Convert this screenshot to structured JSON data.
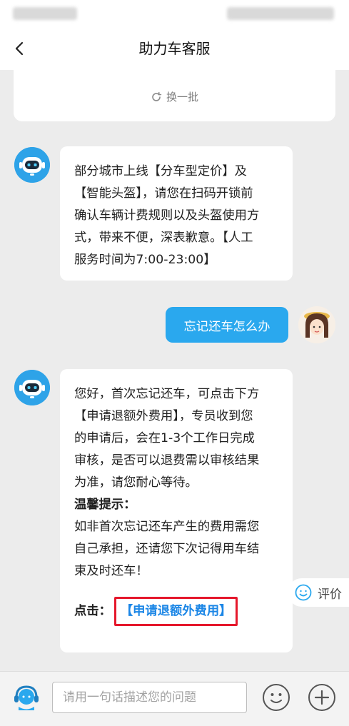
{
  "header": {
    "title": "助力车客服"
  },
  "refresh": {
    "label": "换一批"
  },
  "messages": [
    {
      "from": "bot",
      "lines": [
        "部分城市上线【分车型定价】及",
        "【智能头盔】，请您在扫码开锁前",
        "确认车辆计费规则以及头盔使用方",
        "式，带来不便，深表歉意。【人工",
        "服务时间为7:00-23:00】"
      ]
    },
    {
      "from": "user",
      "text": "忘记还车怎么办"
    },
    {
      "from": "bot",
      "lines": [
        "您好，首次忘记还车，可点击下方",
        "【申请退额外费用】，专员收到您",
        "的申请后，会在1-3个工作日完成",
        "审核，是否可以退费需以审核结果",
        "为准，请您耐心等待。"
      ],
      "tip_title": "温馨提示：",
      "tip_lines": [
        "如非首次忘记还车产生的费用需您",
        "自己承担，还请您下次记得用车结",
        "束及时还车！"
      ],
      "click_label": "点击：",
      "link_text": "【申请退额外费用】"
    }
  ],
  "eval": {
    "label": "评价"
  },
  "input": {
    "placeholder": "请用一句话描述您的问题"
  },
  "icons": {
    "back": "chevron-left-icon",
    "refresh": "refresh-icon",
    "service": "headset-service-icon",
    "emoji": "emoji-icon",
    "plus": "plus-icon",
    "eval": "smile-icon"
  },
  "colors": {
    "accent": "#2aa8ee",
    "link": "#1b86e6",
    "highlight_border": "#e5182c"
  }
}
